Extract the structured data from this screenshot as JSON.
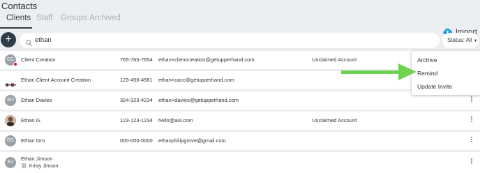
{
  "page": {
    "title": "Contacts"
  },
  "tabs": [
    {
      "label": "Clients",
      "active": true
    },
    {
      "label": "Staff",
      "active": false
    },
    {
      "label": "Groups",
      "active": false
    },
    {
      "label": "Archived",
      "active": false
    }
  ],
  "header": {
    "import_label": "Import",
    "import_icon": "cloud-upload-icon"
  },
  "toolbar": {
    "add_label": "+",
    "search": {
      "value": "ethan",
      "icon": "search-icon"
    },
    "status_filter": {
      "label": "Status: All"
    }
  },
  "contacts": [
    {
      "name": "Client Creation",
      "initials": "CC",
      "phone": "765-765-7654",
      "email": "ethan+clientcreation@getupperhand.com",
      "status": "Unclaimed Account",
      "has_alert_badge": true
    },
    {
      "name": "Ethan Client Account Creation",
      "initials": "",
      "phone": "123-456-4561",
      "email": "ethan+cacc@getupperhand.com",
      "status": ""
    },
    {
      "name": "Ethan Davies",
      "initials": "ED",
      "phone": "324-323-4234",
      "email": "ethan+davies@getupperhand.com",
      "status": ""
    },
    {
      "name": "Ethan G.",
      "initials": "",
      "phone": "123-123-1234",
      "email": "hello@aol.com",
      "status": "Unclaimed Account"
    },
    {
      "name": "Ethan Gro",
      "initials": "EG",
      "phone": "000-000-0000",
      "email": "ethanphilipgrove@gmail.com",
      "status": ""
    },
    {
      "name": "Ethan Jimson",
      "initials": "EJ",
      "phone": "",
      "email": "",
      "status": "",
      "linked_name": "Kristy Jimson"
    }
  ],
  "context_menu": {
    "items": [
      {
        "label": "Archive"
      },
      {
        "label": "Remind"
      },
      {
        "label": "Update Invite"
      }
    ]
  },
  "colors": {
    "background": "#eceff1",
    "primary_dark": "#2d3e48",
    "annotation_arrow": "#6fd352",
    "alert_badge": "#c8102e"
  }
}
